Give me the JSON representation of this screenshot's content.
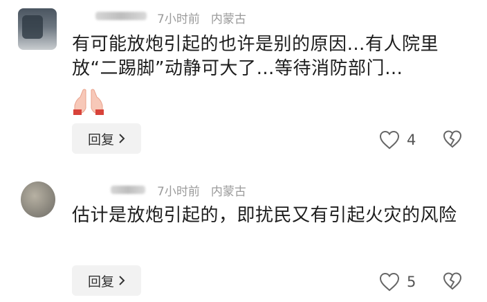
{
  "comments": [
    {
      "time": "7小时前",
      "location": "内蒙古",
      "text": "有可能放炮引起的也许是别的原因…有人院里放“二踢脚”动静可大了…等待消防部门…",
      "reply_label": "回复",
      "like_count": "4",
      "emoji": "folded-hands"
    },
    {
      "time": "7小时前",
      "location": "内蒙古",
      "text": "估计是放炮引起的，即扰民又有引起火灾的风险",
      "reply_label": "回复",
      "like_count": "5"
    }
  ]
}
